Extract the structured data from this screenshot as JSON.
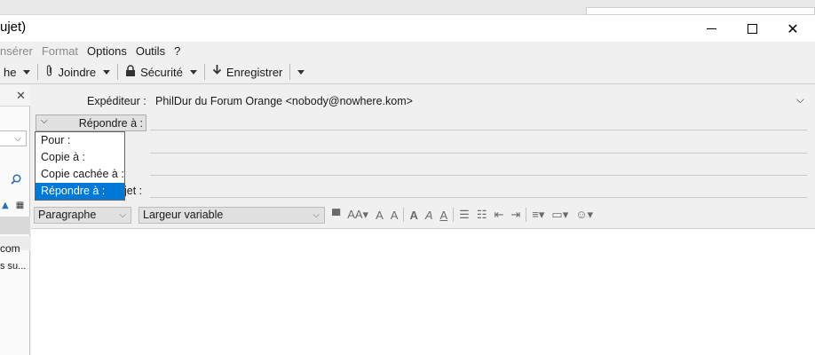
{
  "window": {
    "title": "ujet)",
    "minimize_icon": "minimize-icon",
    "maximize_icon": "maximize-icon",
    "close_icon": "close-icon"
  },
  "menubar": {
    "items": [
      {
        "label": "nsérer",
        "disabled": true
      },
      {
        "label": "Format",
        "disabled": true
      },
      {
        "label": "Options",
        "disabled": false
      },
      {
        "label": "Outils",
        "disabled": false
      },
      {
        "label": "?",
        "disabled": false
      }
    ]
  },
  "toolbar": {
    "partial_label": "he",
    "attach_label": "Joindre",
    "security_label": "Sécurité",
    "save_label": "Enregistrer"
  },
  "sidebar": {
    "text1": "com",
    "text2": "s su..."
  },
  "compose": {
    "from_label": "Expéditeur :",
    "from_value": "PhilDur du Forum Orange <nobody@nowhere.kom>",
    "address_type_selected": "Répondre à :",
    "subject_label": "jet :"
  },
  "address_type_dropdown": {
    "options": [
      "Pour :",
      "Copie à :",
      "Copie cachée à :",
      "Répondre à :"
    ],
    "selected_index": 3
  },
  "format_toolbar": {
    "paragraph_value": "Paragraphe",
    "font_value": "Largeur variable"
  },
  "colors": {
    "selection": "#0078d7",
    "toolbar_bg": "#f0f0f0",
    "editor_bg": "#ffffff"
  }
}
